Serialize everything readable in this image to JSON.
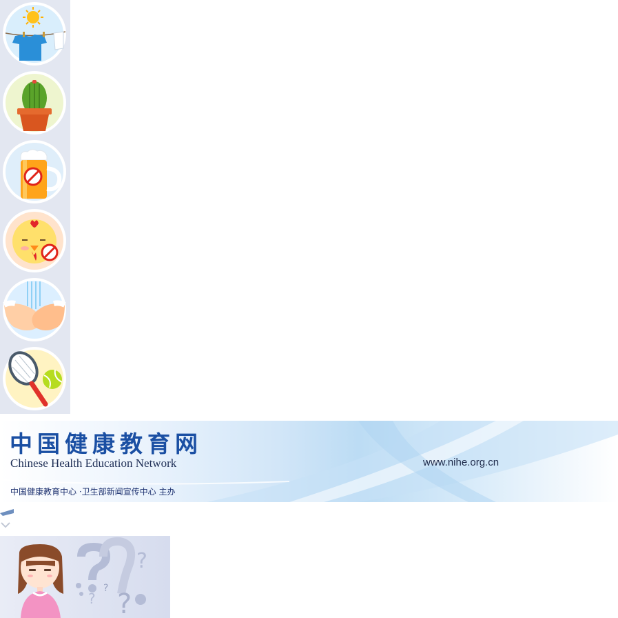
{
  "icons": [
    {
      "name": "sun-clothesline-icon"
    },
    {
      "name": "cactus-pot-icon"
    },
    {
      "name": "no-beer-icon"
    },
    {
      "name": "no-chicken-icon"
    },
    {
      "name": "hand-washing-icon"
    },
    {
      "name": "tennis-racket-icon"
    }
  ],
  "banner": {
    "title": "中国健康教育网",
    "subtitle": "Chinese Health Education Network",
    "url": "www.nihe.org.cn",
    "org": "中国健康教育中心 ·卫生部新闻宣传中心 主办",
    "title_color": "#1a4fa3"
  },
  "question_panel": {
    "character": "girl-avatar",
    "decoration": "question-marks-icon"
  }
}
